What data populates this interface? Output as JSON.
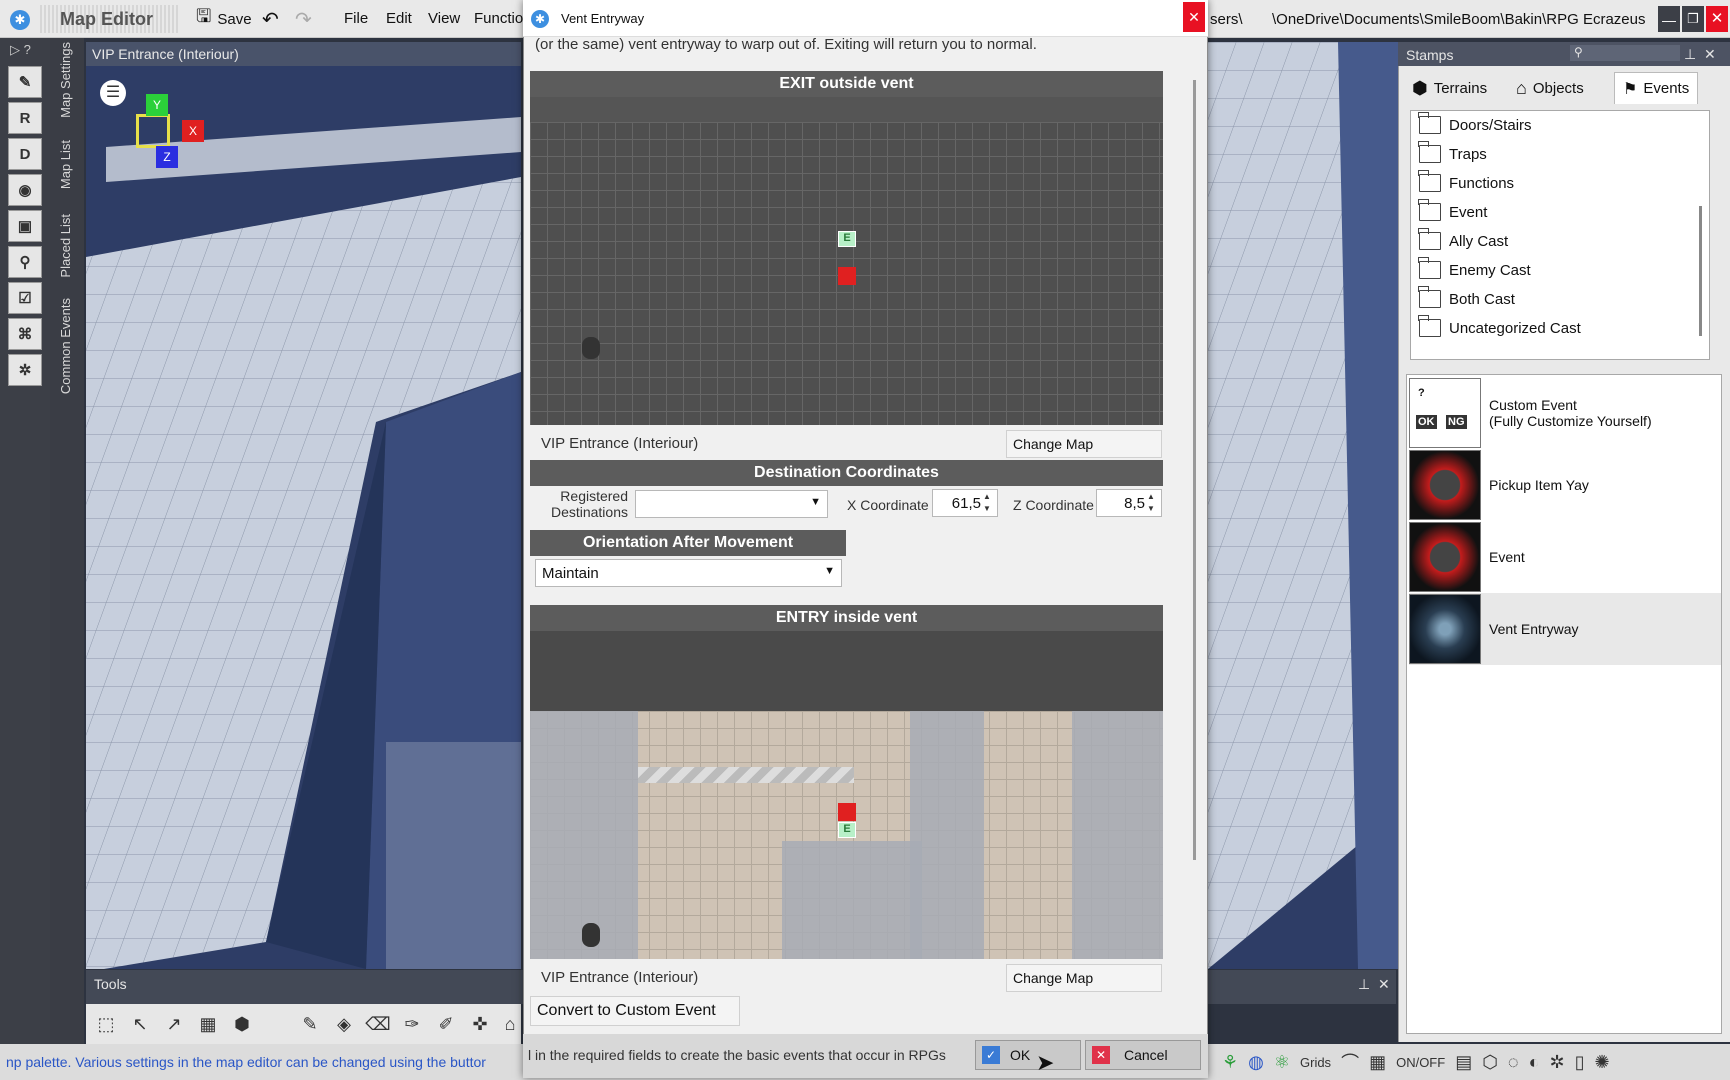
{
  "app": {
    "title": "Map Editor",
    "save_label": "Save",
    "path": "\\OneDrive\\Documents\\SmileBoom\\Bakin\\RPG Ecrazeus",
    "path_prefix": "sers\\",
    "menus": [
      "File",
      "Edit",
      "View",
      "Functio"
    ]
  },
  "left_tabs": [
    "Map Settings",
    "Map List",
    "Placed List",
    "Common Events"
  ],
  "viewport": {
    "title": "VIP Entrance (Interiour)",
    "axes": {
      "x": "X",
      "y": "Y",
      "z": "Z"
    }
  },
  "dialog": {
    "title": "Vent Entryway",
    "intro": "(or the same) vent entryway to warp out of. Exiting will return you to normal.",
    "exit_section": {
      "header": "EXIT outside vent",
      "map_name": "VIP Entrance (Interiour)",
      "change_map": "Change Map",
      "marker": "E"
    },
    "destination": {
      "header": "Destination Coordinates",
      "registered_label": "Registered Destinations",
      "registered_value": "",
      "x_label": "X Coordinate",
      "x_value": "61,5",
      "z_label": "Z Coordinate",
      "z_value": "8,5"
    },
    "orientation": {
      "header": "Orientation After Movement",
      "value": "Maintain"
    },
    "entry_section": {
      "header": "ENTRY inside vent",
      "map_name": "VIP Entrance (Interiour)",
      "change_map": "Change Map",
      "marker": "E"
    },
    "convert_label": "Convert to Custom Event",
    "hint": "l in the required fields to create the basic events that occur in RPGs",
    "ok_label": "OK",
    "cancel_label": "Cancel"
  },
  "tools": {
    "title": "Tools"
  },
  "status": {
    "text": "np palette.  Various settings in the map editor can be changed using the buttor",
    "grids_label": "Grids",
    "onoff_label": "ON/OFF"
  },
  "stamps": {
    "title": "Stamps",
    "tabs": [
      "Terrains",
      "Objects",
      "Events"
    ],
    "folders": [
      "Doors/Stairs",
      "Traps",
      "Functions",
      "Event",
      "Ally Cast",
      "Enemy Cast",
      "Both Cast",
      "Uncategorized Cast"
    ],
    "events": [
      {
        "name": "Custom Event",
        "sub": "(Fully Customize Yourself)"
      },
      {
        "name": "Pickup Item Yay",
        "sub": ""
      },
      {
        "name": "Event",
        "sub": ""
      },
      {
        "name": "Vent Entryway",
        "sub": ""
      }
    ]
  },
  "colors": {
    "accent": "#2a56c6",
    "close_red": "#e81123",
    "marker_red": "#e02020",
    "marker_green": "#b8f0c8"
  }
}
